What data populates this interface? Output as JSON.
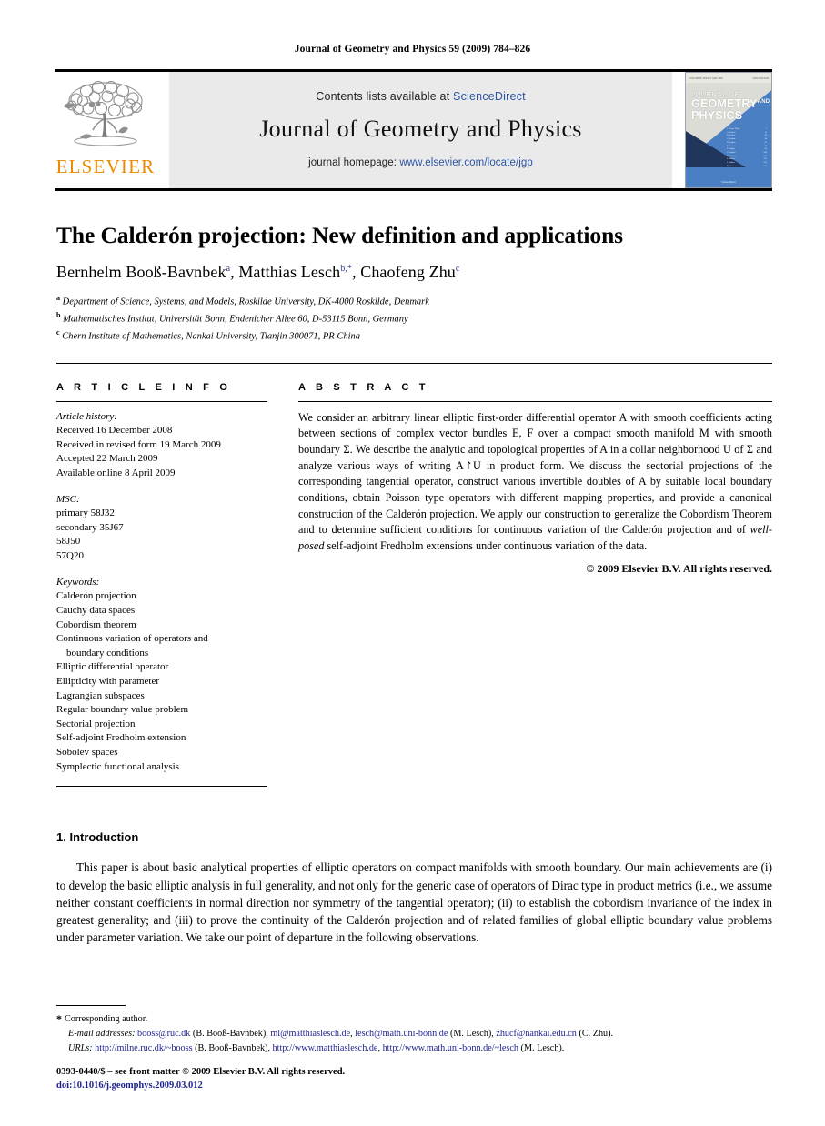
{
  "running_head": "Journal of Geometry and Physics 59 (2009) 784–826",
  "masthead": {
    "publisher_name": "ELSEVIER",
    "contents_prefix": "Contents lists available at ",
    "contents_link": "ScienceDirect",
    "journal_name": "Journal of Geometry and Physics",
    "homepage_prefix": "journal homepage: ",
    "homepage_url": "www.elsevier.com/locate/jgp",
    "accent_link_color": "#2b55a4",
    "elsevier_orange": "#ED8B00"
  },
  "cover": {
    "top_left": "VOLUME 59, ISSUE 6, MAY 2009",
    "top_right": "ISSN 0393-0440",
    "line1": "JOURNAL OF",
    "line2": "GEOMETRY",
    "line2_sup": "AND",
    "line3": "PHYSICS",
    "footer": "ScienceDirect",
    "background_color": "#4b7fc4",
    "toc_rows": [
      [
        "J. Geom. Phys.",
        "1"
      ],
      [
        "A. Author",
        "15"
      ],
      [
        "B. Author",
        "29"
      ],
      [
        "C. Author",
        "44"
      ],
      [
        "D. Author",
        "61"
      ],
      [
        "E. Author",
        "77"
      ],
      [
        "F. Author",
        "92"
      ],
      [
        "G. Author",
        "108"
      ],
      [
        "H. Author",
        "121"
      ],
      [
        "I. Author",
        "137"
      ],
      [
        "J. Author",
        "155"
      ],
      [
        "K. Author",
        "170"
      ]
    ]
  },
  "article": {
    "title": "The Calderón projection: New definition and applications",
    "authors": [
      {
        "name": "Bernhelm Booß-Bavnbek",
        "sup": "a",
        "star": false
      },
      {
        "name": "Matthias Lesch",
        "sup": "b",
        "star": true
      },
      {
        "name": "Chaofeng Zhu",
        "sup": "c",
        "star": false
      }
    ],
    "affiliations": [
      {
        "mark": "a",
        "text": "Department of Science, Systems, and Models, Roskilde University, DK-4000 Roskilde, Denmark"
      },
      {
        "mark": "b",
        "text": "Mathematisches Institut, Universität Bonn, Endenicher Allee 60, D-53115 Bonn, Germany"
      },
      {
        "mark": "c",
        "text": "Chern Institute of Mathematics, Nankai University, Tianjin 300071, PR China"
      }
    ]
  },
  "info": {
    "heading": "A R T I C L E   I N F O",
    "history_label": "Article history:",
    "history": [
      "Received 16 December 2008",
      "Received in revised form 19 March 2009",
      "Accepted 22 March 2009",
      "Available online 8 April 2009"
    ],
    "msc_label": "MSC:",
    "msc": [
      "primary 58J32",
      "secondary 35J67",
      "58J50",
      "57Q20"
    ],
    "keywords_label": "Keywords:",
    "keywords": [
      {
        "text": "Calderón projection",
        "indent": false
      },
      {
        "text": "Cauchy data spaces",
        "indent": false
      },
      {
        "text": "Cobordism theorem",
        "indent": false
      },
      {
        "text": "Continuous variation of operators and",
        "indent": false
      },
      {
        "text": "boundary conditions",
        "indent": true
      },
      {
        "text": "Elliptic differential operator",
        "indent": false
      },
      {
        "text": "Ellipticity with parameter",
        "indent": false
      },
      {
        "text": "Lagrangian subspaces",
        "indent": false
      },
      {
        "text": "Regular boundary value problem",
        "indent": false
      },
      {
        "text": "Sectorial projection",
        "indent": false
      },
      {
        "text": "Self-adjoint Fredholm extension",
        "indent": false
      },
      {
        "text": "Sobolev spaces",
        "indent": false
      },
      {
        "text": "Symplectic functional analysis",
        "indent": false
      }
    ]
  },
  "abstract": {
    "heading": "A B S T R A C T",
    "paragraph_part1": "We consider an arbitrary linear elliptic first-order differential operator A with smooth coefficients acting between sections of complex vector bundles E, F over a compact smooth manifold M with smooth boundary Σ. We describe the analytic and topological properties of A in a collar neighborhood U of Σ and analyze various ways of writing A↾U in product form. We discuss the sectorial projections of the corresponding tangential operator, construct various invertible doubles of A by suitable local boundary conditions, obtain Poisson type operators with different mapping properties, and provide a canonical construction of the Calderón projection. We apply our construction to generalize the Cobordism Theorem and to determine sufficient conditions for continuous variation of the Calderón projection and of ",
    "paragraph_italic": "well-posed",
    "paragraph_part2": " self-adjoint Fredholm extensions under continuous variation of the data.",
    "copyright": "© 2009 Elsevier B.V. All rights reserved."
  },
  "body": {
    "section_number_title": "1.  Introduction",
    "paragraph": "This paper is about basic analytical properties of elliptic operators on compact manifolds with smooth boundary. Our main achievements are (i) to develop the basic elliptic analysis in full generality, and not only for the generic case of operators of Dirac type in product metrics (i.e., we assume neither constant coefficients in normal direction nor symmetry of the tangential operator); (ii) to establish the cobordism invariance of the index in greatest generality; and (iii) to prove the continuity of the Calderón projection and of related families of global elliptic boundary value problems under parameter variation. We take our point of departure in the following observations."
  },
  "footnotes": {
    "corresponding": "Corresponding author.",
    "email_label": "E-mail addresses:",
    "emails": [
      {
        "address": "booss@ruc.dk",
        "who": " (B. Booß-Bavnbek), "
      },
      {
        "address": "ml@matthiaslesch.de",
        "who": ", "
      },
      {
        "address": "lesch@math.uni-bonn.de",
        "who": " (M. Lesch), "
      },
      {
        "address": "zhucf@nankai.edu.cn",
        "who": " (C. Zhu)."
      }
    ],
    "urls_label": "URLs:",
    "urls": [
      {
        "address": "http://milne.ruc.dk/~booss",
        "who": " (B. Booß-Bavnbek), "
      },
      {
        "address": "http://www.matthiaslesch.de",
        "who": ", "
      },
      {
        "address": "http://www.math.uni-bonn.de/~lesch",
        "who": " (M. Lesch)."
      }
    ],
    "link_color": "#1a1f8f"
  },
  "imprint": {
    "line1": "0393-0440/$ – see front matter © 2009 Elsevier B.V. All rights reserved.",
    "doi": "doi:10.1016/j.geomphys.2009.03.012"
  }
}
